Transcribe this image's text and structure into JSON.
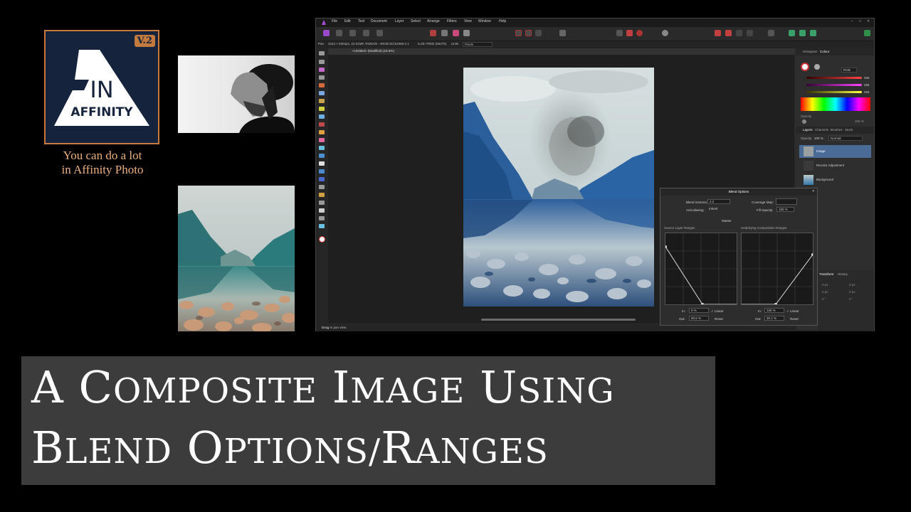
{
  "logo": {
    "badge": "V.2",
    "line1": "IN",
    "line2": "AFFINITY"
  },
  "tagline": {
    "line1": "You can do a lot",
    "line2": "in Affinity Photo"
  },
  "app": {
    "menu": [
      "File",
      "Edit",
      "Text",
      "Document",
      "Layer",
      "Select",
      "Arrange",
      "Filters",
      "View",
      "Window",
      "Help"
    ],
    "context": {
      "tool": "Pan",
      "info": "4244 × 5304px, 22.51MP, RGBA/8 - sRGB IEC61966-2.1",
      "camera": "ILCE-7RM2 (65475)",
      "units_label": "Units",
      "units_value": "Pixels"
    },
    "doc_tab": "<Untitled> (Modified) (15.5%)",
    "status": {
      "bold": "Drag",
      "rest": "to pan view."
    },
    "panels": {
      "top_tabs": [
        "Histogram",
        "Colour"
      ],
      "colour_mode": "RGB",
      "rgb_values": [
        "255",
        "255",
        "255"
      ],
      "opacity_label": "Opacity",
      "opacity_value": "100 %",
      "layer_tabs": [
        "Layers",
        "Channels",
        "Brushes",
        "Stock"
      ],
      "layer_opacity": "100 %",
      "blend_mode": "Normal",
      "layers": [
        "Image",
        "Recolor Adjustment",
        "Background"
      ],
      "bottom_tabs": [
        "Transform",
        "History"
      ],
      "transform_vals": [
        "0 px",
        "0 px",
        "0 px",
        "0 px",
        "0 °",
        "0 °"
      ]
    }
  },
  "blend_dialog": {
    "title": "Blend Options",
    "gamma_label": "Blend Gamma:",
    "gamma_value": "2.2",
    "coverage_label": "Coverage Map:",
    "antialias_label": "Anti-aliasing:",
    "antialias_value": "Inherit",
    "fill_label": "Fill Opacity:",
    "fill_value": "100 %",
    "channel": "Master",
    "source_label": "Source Layer Ranges",
    "underlying_label": "Underlying Composition Ranges",
    "left": {
      "in_label": "In:",
      "in_value": "0 %",
      "out_label": "Out:",
      "out_value": "80.6 %",
      "linear": "Linear",
      "reset": "Reset"
    },
    "right": {
      "in_label": "In:",
      "in_value": "100 %",
      "out_label": "Out:",
      "out_value": "30.1 %",
      "linear": "Linear",
      "reset": "Reset"
    }
  },
  "title": {
    "line1_caps": [
      "A",
      "C",
      "I",
      "U"
    ],
    "line1_small": [
      "",
      "OMPOSITE",
      "MAGE",
      "SING"
    ],
    "line2_caps": [
      "B",
      "O",
      "R"
    ],
    "line2_small": [
      "LEND",
      "PTIONS/",
      "ANGES"
    ]
  },
  "colors": {
    "accent": "#c77a3c",
    "logo_bg": "#15233d",
    "title_bg": "#3c3c3c",
    "selected_layer": "#4a6b96"
  }
}
